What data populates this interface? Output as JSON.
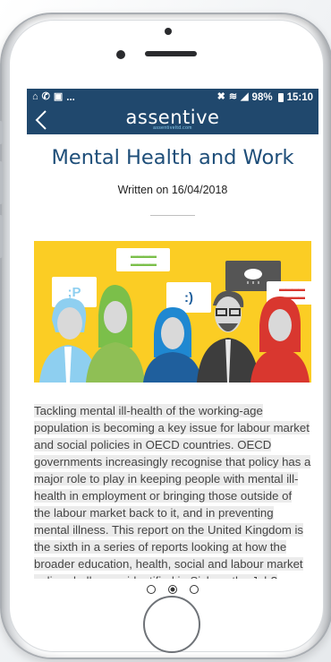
{
  "status_bar": {
    "left_icons": [
      "home-icon",
      "whatsapp-icon",
      "gallery-icon"
    ],
    "left_more": "...",
    "signal_text": "⚟ ≋ ◢",
    "battery_pct": "98%",
    "time": "15:10"
  },
  "app": {
    "brand": "assentive",
    "brand_sub": "assentiveltd.com",
    "back_icon": "chevron-left-icon",
    "colors": {
      "app_bar": "#20486d",
      "accent": "#1e4e79",
      "illustration_bg": "#fbcd24"
    }
  },
  "article": {
    "title": "Mental Health and Work",
    "date": "Written on 16/04/2018",
    "illustration_bubbles": [
      ";P",
      ":)"
    ],
    "body": "Tackling mental ill-health of the working-age population is becoming a key issue for labour market and social policies in OECD countries. OECD governments increasingly recognise that policy has a major role to play in keeping people with mental ill-health in employment or bringing those outside of the labour market back to it, and in preventing mental illness. This report on the United Kingdom is the sixth in a series of reports looking at how the broader education, health, social and labour market policy challenges identified in Sick on the Job? Myths and Realities about Mental Health and Work"
  },
  "pager": {
    "pages": 3,
    "active_index": 1
  }
}
